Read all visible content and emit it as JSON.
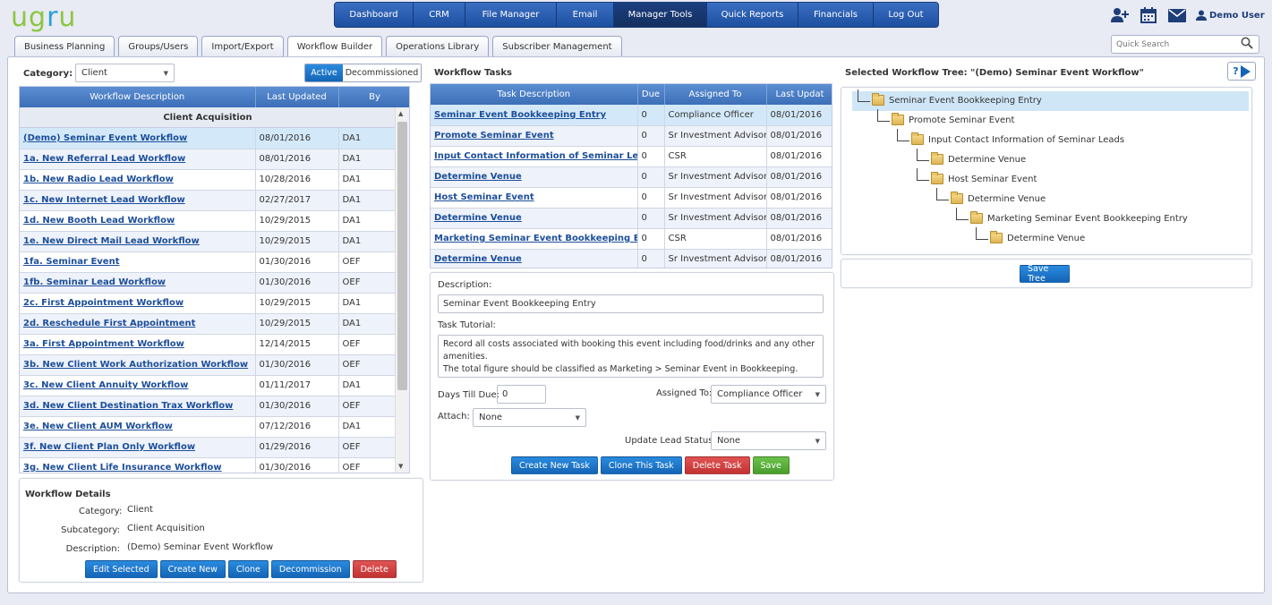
{
  "app": {
    "logo_text_1": "ug",
    "logo_text_2": "r",
    "logo_text_3": "u"
  },
  "topnav": [
    "Dashboard",
    "CRM",
    "File Manager",
    "Email",
    "Manager Tools",
    "Quick Reports",
    "Financials",
    "Log Out"
  ],
  "topnav_active": "Manager Tools",
  "user": {
    "name": "Demo User"
  },
  "tabs": [
    "Business Planning",
    "Groups/Users",
    "Import/Export",
    "Workflow Builder",
    "Operations Library",
    "Subscriber Management"
  ],
  "active_tab": "Workflow Builder",
  "search": {
    "placeholder": "Quick Search"
  },
  "left": {
    "category_label": "Category:",
    "category_value": "Client",
    "toggle": {
      "active": "Active",
      "decommissioned": "Decommissioned"
    },
    "columns": [
      "Workflow Description",
      "Last Updated",
      "By"
    ],
    "group_title": "Client Acquisition",
    "rows": [
      {
        "desc": "(Demo) Seminar Event Workflow",
        "date": "08/01/2016",
        "by": "DA1"
      },
      {
        "desc": "1a. New Referral Lead Workflow",
        "date": "08/01/2016",
        "by": "DA1"
      },
      {
        "desc": "1b. New Radio Lead Workflow",
        "date": "10/28/2016",
        "by": "DA1"
      },
      {
        "desc": "1c. New Internet Lead Workflow",
        "date": "02/27/2017",
        "by": "DA1"
      },
      {
        "desc": "1d. New Booth Lead Workflow",
        "date": "10/29/2015",
        "by": "DA1"
      },
      {
        "desc": "1e. New Direct Mail Lead Workflow",
        "date": "10/29/2015",
        "by": "DA1"
      },
      {
        "desc": "1fa. Seminar Event",
        "date": "01/30/2016",
        "by": "OEF"
      },
      {
        "desc": "1fb. Seminar Lead Workflow",
        "date": "01/30/2016",
        "by": "OEF"
      },
      {
        "desc": "2c. First Appointment Workflow",
        "date": "10/29/2015",
        "by": "DA1"
      },
      {
        "desc": "2d. Reschedule First Appointment",
        "date": "10/29/2015",
        "by": "DA1"
      },
      {
        "desc": "3a. First Appointment Workflow",
        "date": "12/14/2015",
        "by": "OEF"
      },
      {
        "desc": "3b. New Client Work Authorization Workflow",
        "date": "01/30/2016",
        "by": "OEF"
      },
      {
        "desc": "3c. New Client Annuity Workflow",
        "date": "01/11/2017",
        "by": "DA1"
      },
      {
        "desc": "3d. New Client Destination Trax Workflow",
        "date": "01/30/2016",
        "by": "OEF"
      },
      {
        "desc": "3e. New Client AUM Workflow",
        "date": "07/12/2016",
        "by": "DA1"
      },
      {
        "desc": "3f. New Client Plan Only Workflow",
        "date": "01/29/2016",
        "by": "OEF"
      },
      {
        "desc": "3g. New Client Life Insurance Workflow",
        "date": "01/30/2016",
        "by": "OEF"
      }
    ],
    "details": {
      "title": "Workflow Details",
      "category_label": "Category:",
      "category": "Client",
      "subcategory_label": "Subcategory:",
      "subcategory": "Client Acquisition",
      "description_label": "Description:",
      "description": "(Demo) Seminar Event Workflow",
      "buttons": [
        "Edit Selected",
        "Create New",
        "Clone",
        "Decommission",
        "Delete"
      ]
    }
  },
  "tasks": {
    "title": "Workflow Tasks",
    "columns": [
      "Task Description",
      "Due",
      "Assigned To",
      "Last Updat"
    ],
    "rows": [
      {
        "desc": "Seminar Event Bookkeeping Entry",
        "due": "0",
        "assigned": "Compliance Officer",
        "date": "08/01/2016"
      },
      {
        "desc": "Promote Seminar Event",
        "due": "0",
        "assigned": "Sr Investment Advisor",
        "date": "08/01/2016"
      },
      {
        "desc": "Input Contact Information of Seminar Leads",
        "due": "0",
        "assigned": "CSR",
        "date": "08/01/2016"
      },
      {
        "desc": "Determine Venue",
        "due": "0",
        "assigned": "Sr Investment Advisor",
        "date": "08/01/2016"
      },
      {
        "desc": "Host Seminar Event",
        "due": "0",
        "assigned": "Sr Investment Advisor",
        "date": "08/01/2016"
      },
      {
        "desc": "Determine Venue",
        "due": "0",
        "assigned": "Sr Investment Advisor",
        "date": "08/01/2016"
      },
      {
        "desc": "Marketing Seminar Event Bookkeeping Entry",
        "due": "0",
        "assigned": "CSR",
        "date": "08/01/2016"
      },
      {
        "desc": "Determine Venue",
        "due": "0",
        "assigned": "Sr Investment Advisor",
        "date": "08/01/2016"
      }
    ],
    "form": {
      "description_label": "Description:",
      "description_value": "Seminar Event Bookkeeping Entry",
      "tutorial_label": "Task Tutorial:",
      "tutorial_value": "Record all costs associated with booking this event including food/drinks and any other amenities.\nThe total figure should be classified as Marketing > Seminar Event in Bookkeeping.",
      "days_label": "Days Till Due:",
      "days_value": "0",
      "assigned_label": "Assigned To:",
      "assigned_value": "Compliance Officer",
      "attach_label": "Attach:",
      "attach_value": "None",
      "status_label": "Update Lead Status:",
      "status_value": "None",
      "buttons": [
        "Create New Task",
        "Clone This Task",
        "Delete Task",
        "Save"
      ]
    }
  },
  "tree": {
    "title": "Selected Workflow Tree: \"(Demo) Seminar Event Workflow\"",
    "help_label": "?",
    "nodes": [
      "Seminar Event Bookkeeping Entry",
      "Promote Seminar Event",
      "Input Contact Information of Seminar Leads",
      "Determine Venue",
      "Host Seminar Event",
      "Determine Venue",
      "Marketing Seminar Event Bookkeeping Entry",
      "Determine Venue"
    ],
    "save_button": "Save Tree"
  },
  "colors": {
    "nav": "#2a5bae",
    "header": "#4a7ec6",
    "link": "#1c4e9a",
    "selected": "#d3e9f9",
    "logo_green": "#8cc63f",
    "logo_blue": "#2a9fd6"
  },
  "icons": [
    "add-user-icon",
    "calendar-icon",
    "mail-icon",
    "user-icon",
    "search-icon",
    "help-icon",
    "play-icon"
  ]
}
